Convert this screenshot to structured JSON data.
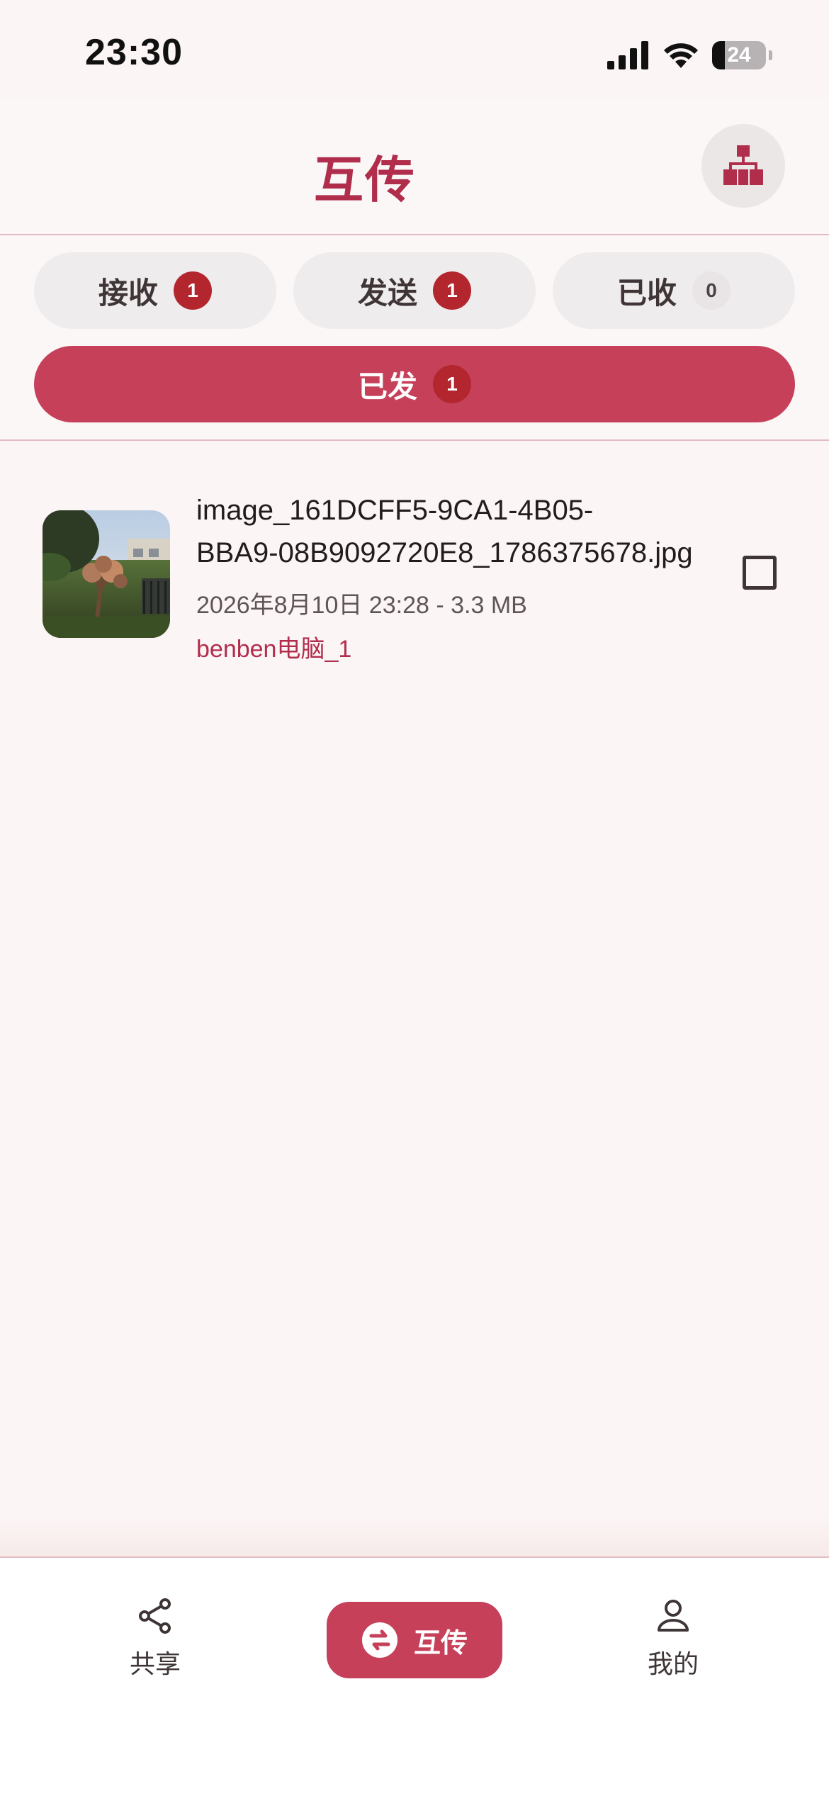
{
  "status_bar": {
    "time": "23:30",
    "battery_level": "24",
    "battery_fraction": 0.24
  },
  "header": {
    "title": "互传",
    "action_icon": "network-icon"
  },
  "tabs": [
    {
      "label": "接收",
      "count": "1",
      "active": false
    },
    {
      "label": "发送",
      "count": "1",
      "active": false
    },
    {
      "label": "已收",
      "count": "0",
      "active": false
    },
    {
      "label": "已发",
      "count": "1",
      "active": true
    }
  ],
  "files": [
    {
      "name_line1": "image_161DCFF5-9CA1-4B05-",
      "name_line2": "BBA9-08B9092720E8_1786375678.jpg",
      "meta": "2026年8月10日 23:28 - 3.3 MB",
      "source": "benben电脑_1",
      "checked": false
    }
  ],
  "bottom_nav": {
    "share_label": "共享",
    "transfer_label": "互传",
    "mine_label": "我的"
  },
  "colors": {
    "accent": "#c6405a",
    "title": "#b12d4c",
    "badge": "#b3262e",
    "background": "#fcf5f5"
  }
}
